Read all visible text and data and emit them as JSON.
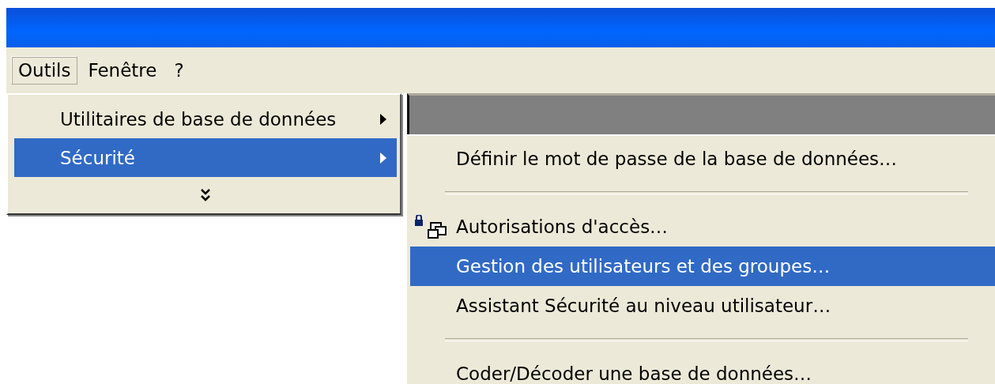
{
  "menubar": [
    {
      "label": "Outils",
      "selected": true
    },
    {
      "label": "Fenêtre",
      "selected": false
    },
    {
      "label": "?",
      "selected": false
    }
  ],
  "menu": {
    "items": [
      {
        "kind": "submenu",
        "label": "Utilitaires de base de données",
        "selected": false
      },
      {
        "kind": "submenu",
        "label": "Sécurité",
        "selected": true
      },
      {
        "kind": "expand"
      }
    ]
  },
  "submenu": {
    "items": [
      {
        "kind": "item",
        "label": "Définir le mot de passe de la base de données…",
        "icon": false,
        "selected": false
      },
      {
        "kind": "separator"
      },
      {
        "kind": "item",
        "label": "Autorisations d'accès…",
        "icon": true,
        "selected": false
      },
      {
        "kind": "item",
        "label": "Gestion des utilisateurs et des groupes…",
        "icon": false,
        "selected": true
      },
      {
        "kind": "item",
        "label": "Assistant Sécurité au niveau utilisateur…",
        "icon": false,
        "selected": false
      },
      {
        "kind": "separator"
      },
      {
        "kind": "item",
        "label": "Coder/Décoder une base de données…",
        "icon": false,
        "selected": false
      }
    ]
  }
}
